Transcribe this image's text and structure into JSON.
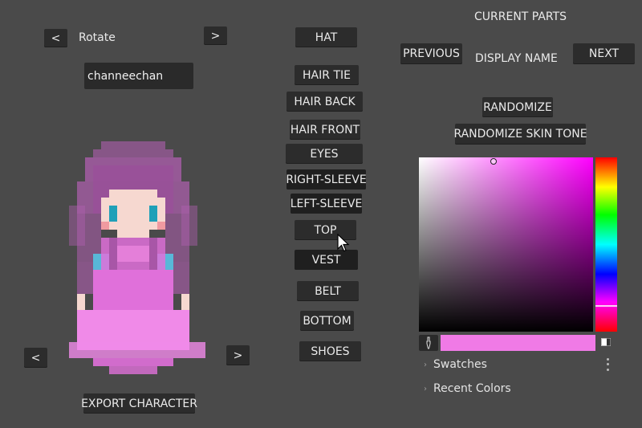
{
  "rotate": {
    "prev": "<",
    "label": "Rotate",
    "next": ">"
  },
  "name_input": {
    "value": "channeechan"
  },
  "parts": [
    {
      "label": "HAT"
    },
    {
      "label": "HAIR TIE"
    },
    {
      "label": "HAIR BACK"
    },
    {
      "label": "HAIR FRONT"
    },
    {
      "label": "EYES"
    },
    {
      "label": "RIGHT-SLEEVE"
    },
    {
      "label": "LEFT-SLEEVE"
    },
    {
      "label": "TOP"
    },
    {
      "label": "VEST"
    },
    {
      "label": "BELT"
    },
    {
      "label": "BOTTOM"
    },
    {
      "label": "SHOES"
    }
  ],
  "current_parts": {
    "title": "CURRENT PARTS",
    "previous": "PREVIOUS",
    "display_name": "DISPLAY NAME",
    "next": "NEXT"
  },
  "randomize": "RANDOMIZE",
  "randomize_skin": "RANDOMIZE SKIN TONE",
  "character_nav": {
    "prev": "<",
    "next": ">"
  },
  "export": "EXPORT CHARACTER",
  "color_picker": {
    "current_color": "#f07ae6",
    "swatches": "Swatches",
    "recent": "Recent Colors"
  },
  "colors": {
    "hair": "#b05fb0",
    "hair_dark": "#9a4f9a",
    "dress": "#e070da",
    "dress_light": "#f08ae8",
    "skin": "#f6d8d0",
    "eyes": "#1fa0b8",
    "blush": "#f09aa0",
    "collar": "#58b8d8"
  }
}
